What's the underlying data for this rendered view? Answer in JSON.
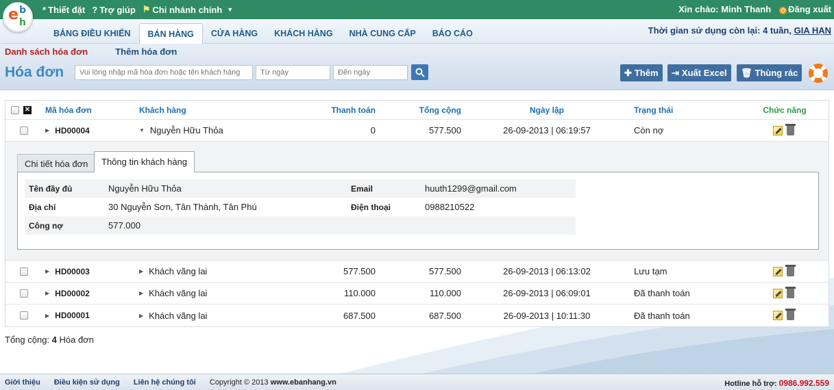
{
  "topbar": {
    "settings": "Thiết đặt",
    "help": "Trợ giúp",
    "branch": "Chi nhánh chính",
    "greeting": "Xin chào: Minh Thanh",
    "logout": "Đăng xuất"
  },
  "nav": {
    "tabs": [
      "BẢNG ĐIỀU KHIỂN",
      "BÁN HÀNG",
      "CỬA HÀNG",
      "KHÁCH HÀNG",
      "NHÀ CUNG CẤP",
      "BÁO CÁO"
    ],
    "usage_text": "Thời gian sử dụng còn lại: 4 tuần,",
    "upgrade": "GIA HẠN"
  },
  "sub": {
    "invoice_list": "Danh sách hóa đơn",
    "add_invoice": "Thêm hóa đơn",
    "page_title": "Hóa đơn",
    "search_placeholder": "Vui lòng nhập mã hóa đơn hoặc tên khách hàng",
    "from_date_placeholder": "Từ ngày",
    "to_date_placeholder": "Đến ngày",
    "add_btn": "Thêm",
    "excel_btn": "Xuất Excel",
    "trash_btn": "Thùng rác"
  },
  "table": {
    "headers": {
      "code": "Mã hóa đơn",
      "customer": "Khách hàng",
      "paid": "Thanh toán",
      "total": "Tổng cộng",
      "date": "Ngày lập",
      "status": "Trạng thái",
      "actions": "Chức năng"
    },
    "rows": [
      {
        "code": "HD00004",
        "customer": "Nguyễn Hữu Thỏa",
        "paid": "0",
        "total": "577.500",
        "date": "26-09-2013 | 06:19:57",
        "status": "Còn nợ"
      },
      {
        "code": "HD00003",
        "customer": "Khách vãng lai",
        "paid": "577.500",
        "total": "577.500",
        "date": "26-09-2013 | 06:13:02",
        "status": "Lưu tạm"
      },
      {
        "code": "HD00002",
        "customer": "Khách vãng lai",
        "paid": "110.000",
        "total": "110.000",
        "date": "26-09-2013 | 06:09:01",
        "status": "Đã thanh toán"
      },
      {
        "code": "HD00001",
        "customer": "Khách vãng lai",
        "paid": "687.500",
        "total": "687.500",
        "date": "26-09-2013 | 10:11:30",
        "status": "Đã thanh toán"
      }
    ]
  },
  "detail": {
    "tab_invoice": "Chi tiết hóa đơn",
    "tab_customer": "Thông tin khách hàng",
    "labels": {
      "fullname": "Tên đầy đủ",
      "address": "Địa chỉ",
      "debt": "Công nợ",
      "email": "Email",
      "phone": "Điện thoại"
    },
    "values": {
      "fullname": "Nguyễn Hữu Thỏa",
      "address": "30 Nguyễn Sơn, Tân Thành, Tân Phú",
      "debt": "577.000",
      "email": "huuth1299@gmail.com",
      "phone": "0988210522"
    }
  },
  "summary": {
    "label": "Tổng cộng:",
    "count": "4",
    "unit": "Hóa đơn"
  },
  "footer": {
    "intro": "Giới thiệu",
    "terms": "Điều kiện sử dụng",
    "contact": "Liên hệ chúng tôi",
    "copyright": "Copyright © 2013",
    "site": "www.ebanhang.vn",
    "hotline_label": "Hotline hỗ trợ:",
    "hotline": "0986.992.559"
  },
  "colors": {
    "topbar": "#2e8b63",
    "title": "#3a89c4",
    "button": "#3f6d9f",
    "link_active": "#b22222",
    "hotline": "#c0151a"
  }
}
